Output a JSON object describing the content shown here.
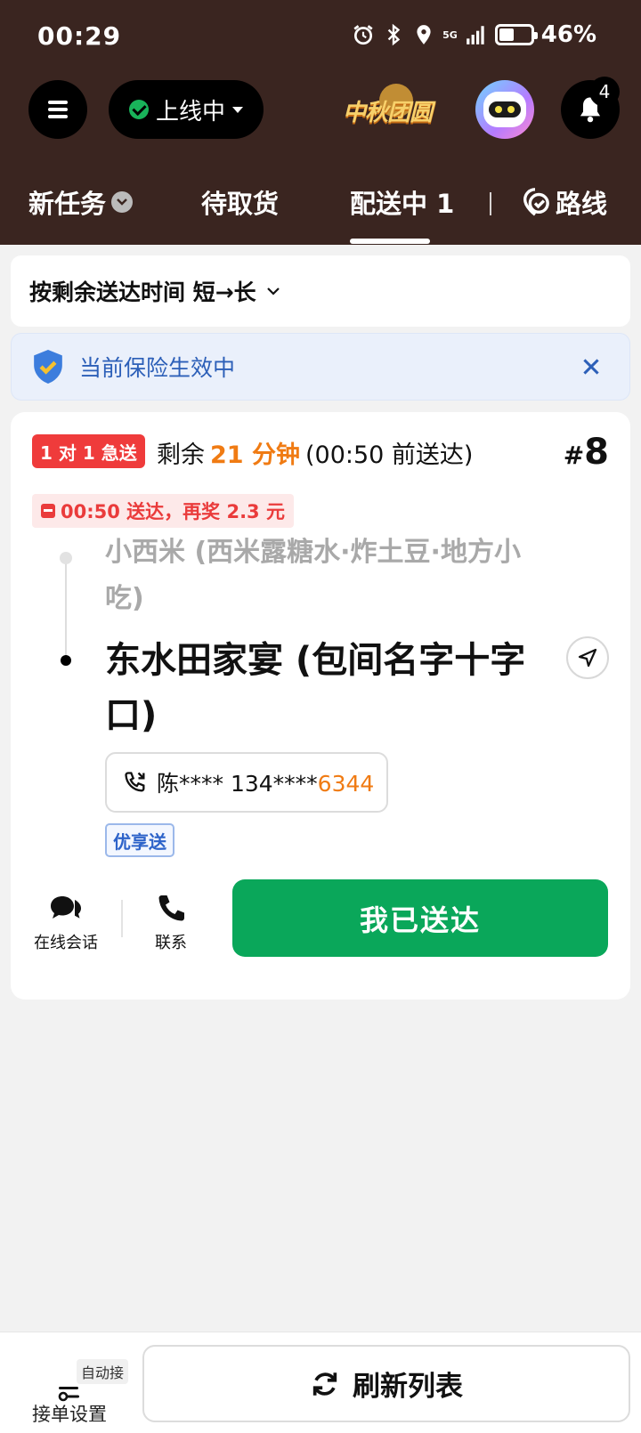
{
  "status_bar": {
    "time": "00:29",
    "network": "5G",
    "battery_text": "46%",
    "battery_level": 0.46
  },
  "header": {
    "online_status": "上线中",
    "logo_text": "中秋团圆",
    "notification_count": "4"
  },
  "tabs": [
    {
      "label": "新任务"
    },
    {
      "label": "待取货"
    },
    {
      "label": "配送中 1",
      "active": true
    },
    {
      "label": "路线"
    }
  ],
  "sort": {
    "label": "按剩余送达时间 短→长"
  },
  "insurance": {
    "text": "当前保险生效中"
  },
  "order": {
    "urgent_badge": "1 对 1 急送",
    "remain_prefix": "剩余",
    "remain_minutes": "21 分钟",
    "deadline": "(00:50 前送达)",
    "number": "8",
    "reward": "00:50 送达，再奖 2.3 元",
    "shop": "小西米 (西米露糖水·炸土豆·地方小吃)",
    "destination": "东水田家宴 (包间名字十字口)",
    "contact_masked": "陈**** 134****",
    "contact_tail": "6344",
    "service_tag": "优享送",
    "actions": {
      "chat": "在线会话",
      "call": "联系",
      "delivered": "我已送达"
    }
  },
  "bottom": {
    "auto_tag": "自动接",
    "settings_label": "接单设置",
    "refresh_label": "刷新列表"
  },
  "colors": {
    "header_bg": "#3a2520",
    "accent_green": "#0aa75a",
    "urgent_red": "#ef3b3b",
    "time_orange": "#f07b13",
    "insurance_blue": "#2c5fb8"
  }
}
